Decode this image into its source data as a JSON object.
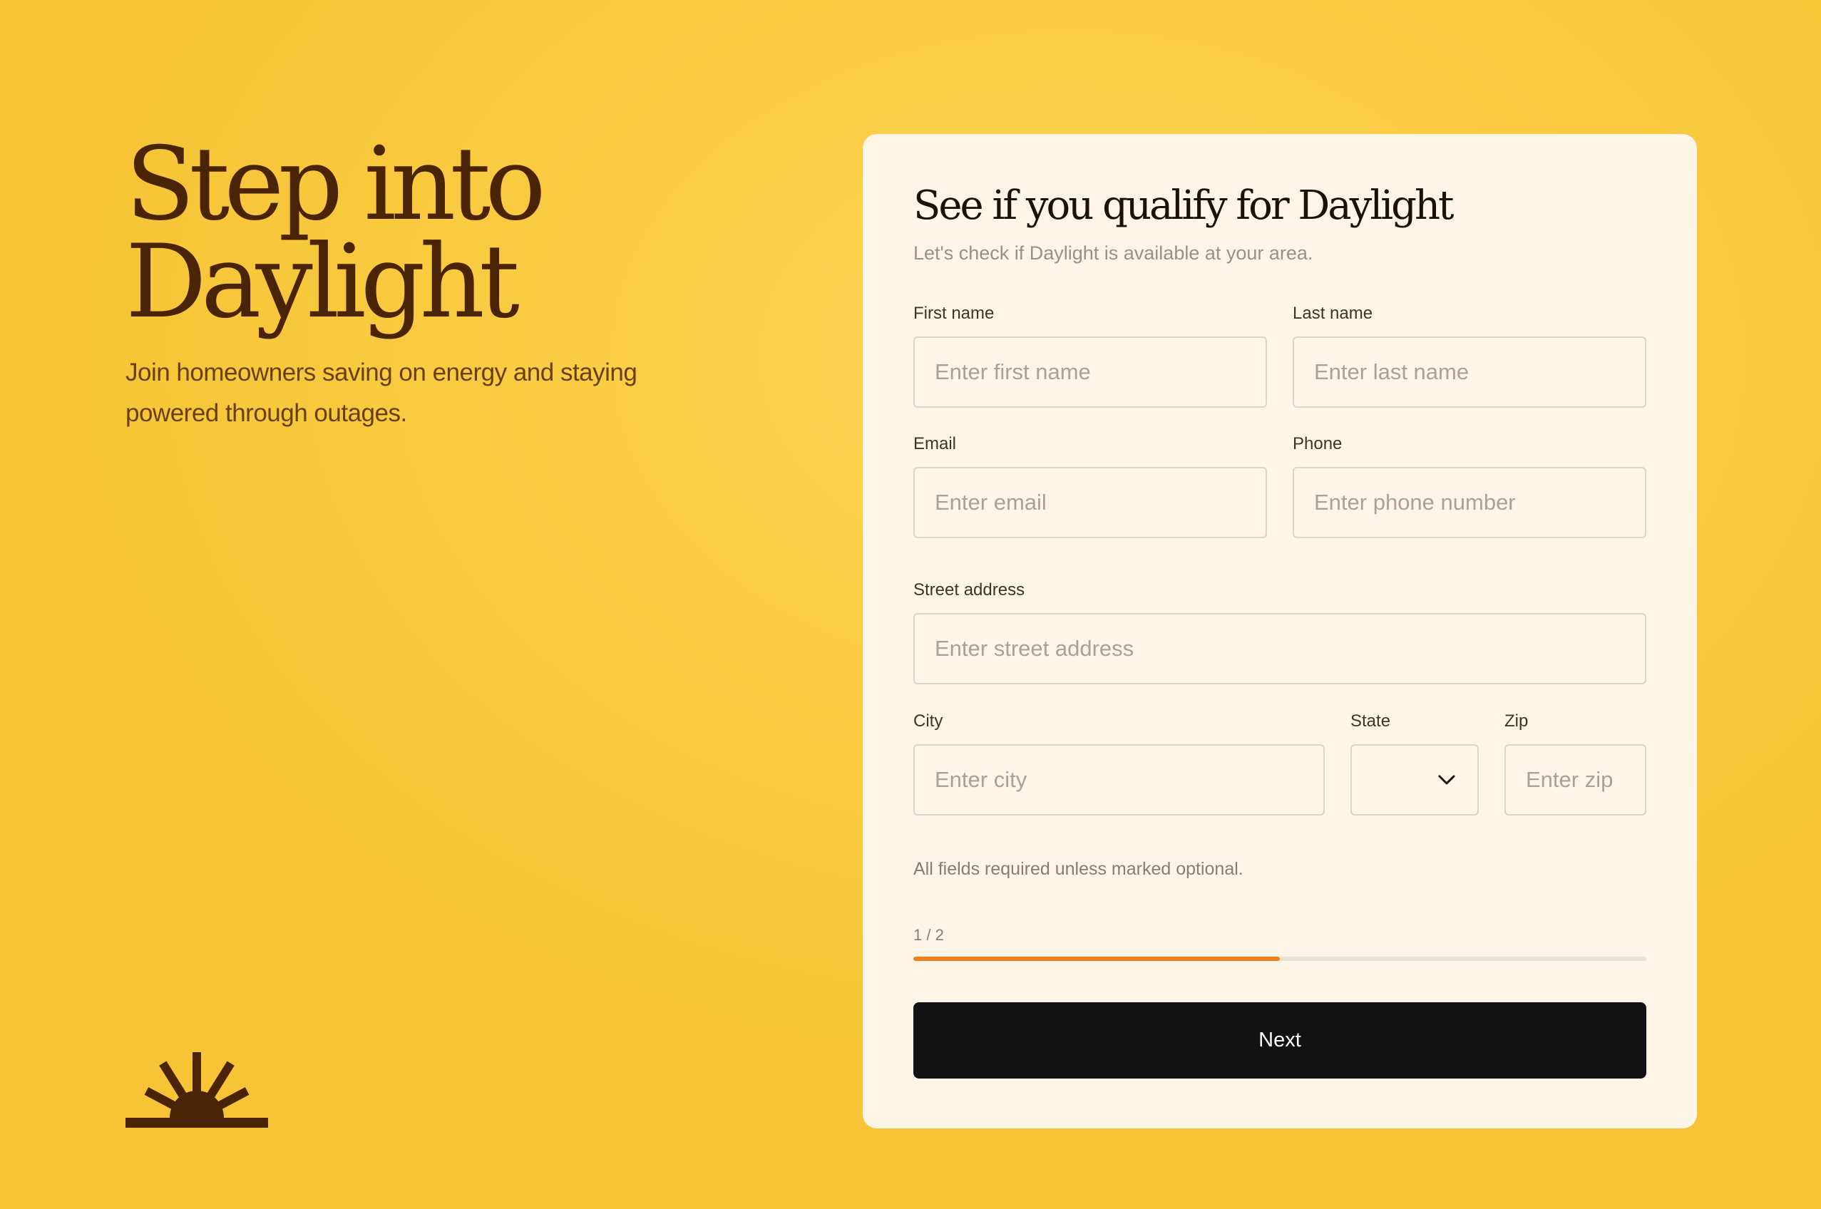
{
  "hero": {
    "title": "Step into Daylight",
    "subtitle": "Join homeowners saving on energy and staying powered through outages."
  },
  "logo": {
    "icon": "sunrise-logo-icon",
    "color": "#4a2405"
  },
  "form": {
    "title": "See if you qualify for Daylight",
    "subtitle": "Let's check if Daylight is available at your area.",
    "fields": {
      "first_name": {
        "label": "First name",
        "placeholder": "Enter first name",
        "value": ""
      },
      "last_name": {
        "label": "Last name",
        "placeholder": "Enter last name",
        "value": ""
      },
      "email": {
        "label": "Email",
        "placeholder": "Enter email",
        "value": ""
      },
      "phone": {
        "label": "Phone",
        "placeholder": "Enter phone number",
        "value": ""
      },
      "street": {
        "label": "Street address",
        "placeholder": "Enter street address",
        "value": ""
      },
      "city": {
        "label": "City",
        "placeholder": "Enter city",
        "value": ""
      },
      "state": {
        "label": "State",
        "selected": "",
        "icon": "chevron-down-icon"
      },
      "zip": {
        "label": "Zip",
        "placeholder": "Enter zip",
        "value": ""
      }
    },
    "note": "All fields required unless marked optional.",
    "progress": {
      "label": "1 / 2",
      "current_step": 1,
      "total_steps": 2,
      "fraction": 0.5,
      "color": "#f07f1d"
    },
    "next_label": "Next"
  },
  "colors": {
    "background": "#fcce47",
    "card": "#fdf6e7",
    "brand_brown": "#4a2405",
    "button": "#121212",
    "accent": "#f07f1d"
  }
}
